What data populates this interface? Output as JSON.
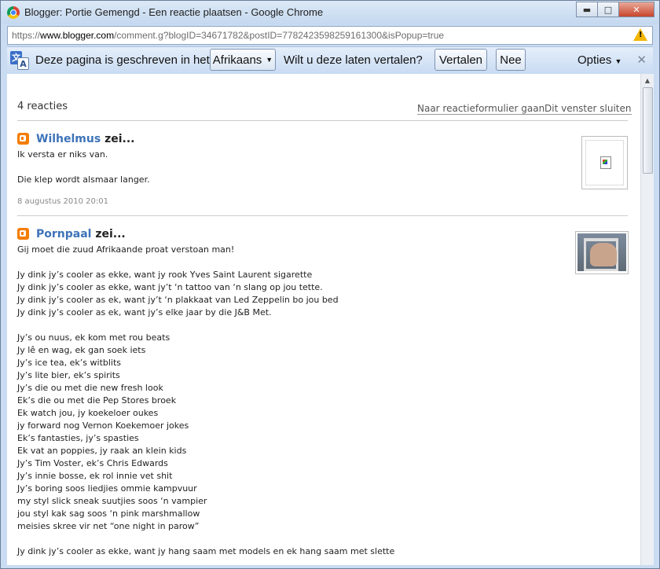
{
  "window": {
    "title": "Blogger: Portie Gemengd - Een reactie plaatsen - Google Chrome",
    "minimize": "▬",
    "maximize": "□",
    "close": "✕"
  },
  "address": {
    "prefix": "https://",
    "host": "www.blogger.com",
    "path": "/comment.g?blogID=34671782&postID=7782423598259161300&isPopup=true"
  },
  "translate_bar": {
    "text1": "Deze pagina is geschreven in het",
    "language": "Afrikaans",
    "question": "Wilt u deze laten vertalen?",
    "translate": "Vertalen",
    "no": "Nee",
    "options": "Opties",
    "close": "✕"
  },
  "header": {
    "count": "4 reacties",
    "link_form": "Naar reactieformulier gaan",
    "link_close": "Dit venster sluiten"
  },
  "comments": [
    {
      "author": "Wilhelmus",
      "said": " zei...",
      "lines": [
        "Ik versta er niks van.",
        "",
        "Die klep wordt alsmaar langer."
      ],
      "date": "8 augustus 2010 20:01"
    },
    {
      "author": "Pornpaal",
      "said": " zei...",
      "lines": [
        "Gij moet die zuud Afrikaande proat verstoan man!",
        "",
        "Jy dink jy’s cooler as ekke, want jy rook Yves Saint Laurent sigarette",
        "Jy dink jy’s cooler as ekke, want jy’t ‘n tattoo van ‘n slang op jou tette.",
        "Jy dink jy’s cooler as ek, want jy’t ‘n plakkaat van Led Zeppelin bo jou bed",
        "Jy dink jy’s cooler as ek, want jy’s elke jaar by die J&B Met.",
        "",
        "Jy’s ou nuus, ek kom met rou beats",
        "Jy lê en wag, ek gan soek iets",
        "Jy’s ice tea, ek’s witblits",
        "Jy’s lite bier, ek’s spirits",
        "Jy’s die ou met die new fresh look",
        "Ek’s die ou met die Pep Stores broek",
        "Ek watch jou, jy koekeloer oukes",
        "jy forward nog Vernon Koekemoer jokes",
        "Ek’s fantasties, jy’s spasties",
        "Ek vat an poppies, jy raak an klein kids",
        "Jy’s Tim Voster, ek’s Chris Edwards",
        "Jy’s innie bosse, ek rol innie vet shit",
        "Jy’s boring soos liedjies ommie kampvuur",
        "my styl slick sneak suutjies soos ‘n vampier",
        "jou styl kak sag soos ‘n pink marshmallow",
        "meisies skree vir net “one night in parow”",
        "",
        "Jy dink jy’s cooler as ekke, want jy hang saam met models en ek hang saam met slette"
      ]
    }
  ]
}
